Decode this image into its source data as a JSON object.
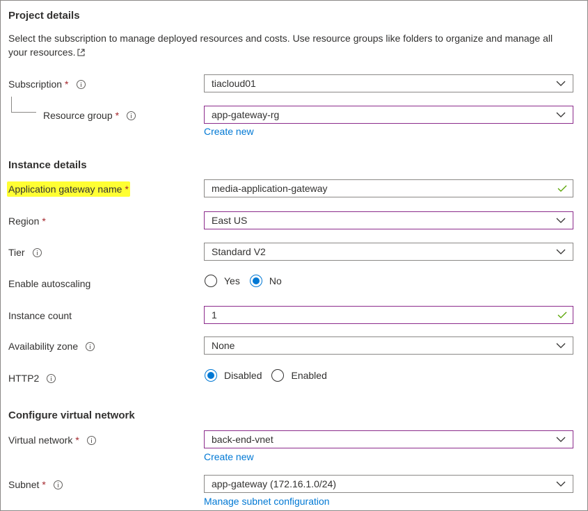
{
  "project": {
    "title": "Project details",
    "description_line1": "Select the subscription to manage deployed resources and costs. Use resource groups like folders to organize and manage all",
    "description_line2": "your resources."
  },
  "subscription": {
    "label": "Subscription",
    "required": "*",
    "value": "tiacloud01"
  },
  "resource_group": {
    "label": "Resource group",
    "required": "*",
    "value": "app-gateway-rg",
    "create_link": "Create new"
  },
  "instance": {
    "title": "Instance details",
    "gateway_name": {
      "label": "Application gateway name",
      "required": "*",
      "value": "media-application-gateway"
    },
    "region": {
      "label": "Region",
      "required": "*",
      "value": "East US"
    },
    "tier": {
      "label": "Tier",
      "value": "Standard V2"
    },
    "autoscaling": {
      "label": "Enable autoscaling",
      "options": [
        "Yes",
        "No"
      ],
      "selected": "No"
    },
    "instance_count": {
      "label": "Instance count",
      "value": "1"
    },
    "availability_zone": {
      "label": "Availability zone",
      "value": "None"
    },
    "http2": {
      "label": "HTTP2",
      "options": [
        "Disabled",
        "Enabled"
      ],
      "selected": "Disabled"
    }
  },
  "network": {
    "title": "Configure virtual network",
    "virtual_network": {
      "label": "Virtual network",
      "required": "*",
      "value": "back-end-vnet",
      "create_link": "Create new"
    },
    "subnet": {
      "label": "Subnet",
      "required": "*",
      "value": "app-gateway (172.16.1.0/24)",
      "manage_link": "Manage subnet configuration"
    }
  },
  "colors": {
    "accent": "#0078d4",
    "required": "#a4262c",
    "valid_check": "#57a300",
    "invalid_border": "#8b2a8b",
    "highlight": "#ffff33"
  }
}
